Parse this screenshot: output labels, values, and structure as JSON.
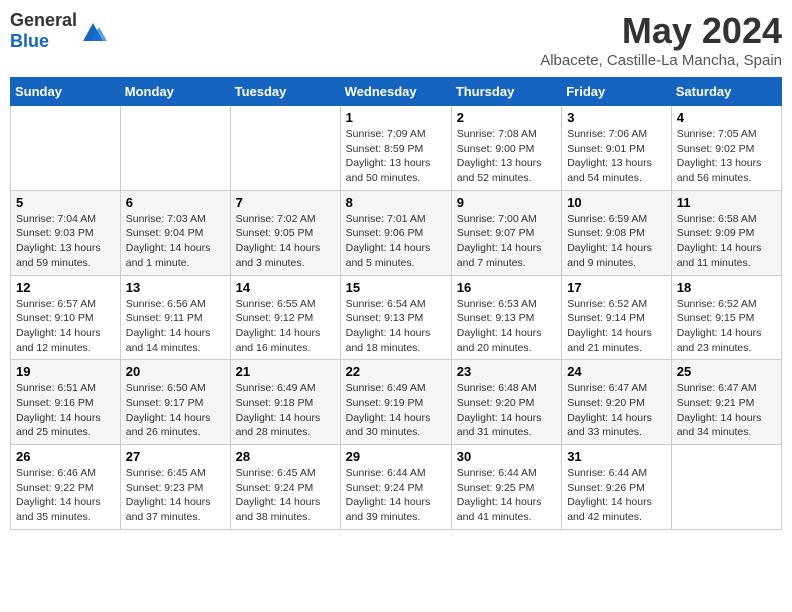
{
  "header": {
    "logo_general": "General",
    "logo_blue": "Blue",
    "month_title": "May 2024",
    "location": "Albacete, Castille-La Mancha, Spain"
  },
  "days_of_week": [
    "Sunday",
    "Monday",
    "Tuesday",
    "Wednesday",
    "Thursday",
    "Friday",
    "Saturday"
  ],
  "weeks": [
    [
      {
        "day": "",
        "sunrise": "",
        "sunset": "",
        "daylight": ""
      },
      {
        "day": "",
        "sunrise": "",
        "sunset": "",
        "daylight": ""
      },
      {
        "day": "",
        "sunrise": "",
        "sunset": "",
        "daylight": ""
      },
      {
        "day": "1",
        "sunrise": "Sunrise: 7:09 AM",
        "sunset": "Sunset: 8:59 PM",
        "daylight": "Daylight: 13 hours and 50 minutes."
      },
      {
        "day": "2",
        "sunrise": "Sunrise: 7:08 AM",
        "sunset": "Sunset: 9:00 PM",
        "daylight": "Daylight: 13 hours and 52 minutes."
      },
      {
        "day": "3",
        "sunrise": "Sunrise: 7:06 AM",
        "sunset": "Sunset: 9:01 PM",
        "daylight": "Daylight: 13 hours and 54 minutes."
      },
      {
        "day": "4",
        "sunrise": "Sunrise: 7:05 AM",
        "sunset": "Sunset: 9:02 PM",
        "daylight": "Daylight: 13 hours and 56 minutes."
      }
    ],
    [
      {
        "day": "5",
        "sunrise": "Sunrise: 7:04 AM",
        "sunset": "Sunset: 9:03 PM",
        "daylight": "Daylight: 13 hours and 59 minutes."
      },
      {
        "day": "6",
        "sunrise": "Sunrise: 7:03 AM",
        "sunset": "Sunset: 9:04 PM",
        "daylight": "Daylight: 14 hours and 1 minute."
      },
      {
        "day": "7",
        "sunrise": "Sunrise: 7:02 AM",
        "sunset": "Sunset: 9:05 PM",
        "daylight": "Daylight: 14 hours and 3 minutes."
      },
      {
        "day": "8",
        "sunrise": "Sunrise: 7:01 AM",
        "sunset": "Sunset: 9:06 PM",
        "daylight": "Daylight: 14 hours and 5 minutes."
      },
      {
        "day": "9",
        "sunrise": "Sunrise: 7:00 AM",
        "sunset": "Sunset: 9:07 PM",
        "daylight": "Daylight: 14 hours and 7 minutes."
      },
      {
        "day": "10",
        "sunrise": "Sunrise: 6:59 AM",
        "sunset": "Sunset: 9:08 PM",
        "daylight": "Daylight: 14 hours and 9 minutes."
      },
      {
        "day": "11",
        "sunrise": "Sunrise: 6:58 AM",
        "sunset": "Sunset: 9:09 PM",
        "daylight": "Daylight: 14 hours and 11 minutes."
      }
    ],
    [
      {
        "day": "12",
        "sunrise": "Sunrise: 6:57 AM",
        "sunset": "Sunset: 9:10 PM",
        "daylight": "Daylight: 14 hours and 12 minutes."
      },
      {
        "day": "13",
        "sunrise": "Sunrise: 6:56 AM",
        "sunset": "Sunset: 9:11 PM",
        "daylight": "Daylight: 14 hours and 14 minutes."
      },
      {
        "day": "14",
        "sunrise": "Sunrise: 6:55 AM",
        "sunset": "Sunset: 9:12 PM",
        "daylight": "Daylight: 14 hours and 16 minutes."
      },
      {
        "day": "15",
        "sunrise": "Sunrise: 6:54 AM",
        "sunset": "Sunset: 9:13 PM",
        "daylight": "Daylight: 14 hours and 18 minutes."
      },
      {
        "day": "16",
        "sunrise": "Sunrise: 6:53 AM",
        "sunset": "Sunset: 9:13 PM",
        "daylight": "Daylight: 14 hours and 20 minutes."
      },
      {
        "day": "17",
        "sunrise": "Sunrise: 6:52 AM",
        "sunset": "Sunset: 9:14 PM",
        "daylight": "Daylight: 14 hours and 21 minutes."
      },
      {
        "day": "18",
        "sunrise": "Sunrise: 6:52 AM",
        "sunset": "Sunset: 9:15 PM",
        "daylight": "Daylight: 14 hours and 23 minutes."
      }
    ],
    [
      {
        "day": "19",
        "sunrise": "Sunrise: 6:51 AM",
        "sunset": "Sunset: 9:16 PM",
        "daylight": "Daylight: 14 hours and 25 minutes."
      },
      {
        "day": "20",
        "sunrise": "Sunrise: 6:50 AM",
        "sunset": "Sunset: 9:17 PM",
        "daylight": "Daylight: 14 hours and 26 minutes."
      },
      {
        "day": "21",
        "sunrise": "Sunrise: 6:49 AM",
        "sunset": "Sunset: 9:18 PM",
        "daylight": "Daylight: 14 hours and 28 minutes."
      },
      {
        "day": "22",
        "sunrise": "Sunrise: 6:49 AM",
        "sunset": "Sunset: 9:19 PM",
        "daylight": "Daylight: 14 hours and 30 minutes."
      },
      {
        "day": "23",
        "sunrise": "Sunrise: 6:48 AM",
        "sunset": "Sunset: 9:20 PM",
        "daylight": "Daylight: 14 hours and 31 minutes."
      },
      {
        "day": "24",
        "sunrise": "Sunrise: 6:47 AM",
        "sunset": "Sunset: 9:20 PM",
        "daylight": "Daylight: 14 hours and 33 minutes."
      },
      {
        "day": "25",
        "sunrise": "Sunrise: 6:47 AM",
        "sunset": "Sunset: 9:21 PM",
        "daylight": "Daylight: 14 hours and 34 minutes."
      }
    ],
    [
      {
        "day": "26",
        "sunrise": "Sunrise: 6:46 AM",
        "sunset": "Sunset: 9:22 PM",
        "daylight": "Daylight: 14 hours and 35 minutes."
      },
      {
        "day": "27",
        "sunrise": "Sunrise: 6:45 AM",
        "sunset": "Sunset: 9:23 PM",
        "daylight": "Daylight: 14 hours and 37 minutes."
      },
      {
        "day": "28",
        "sunrise": "Sunrise: 6:45 AM",
        "sunset": "Sunset: 9:24 PM",
        "daylight": "Daylight: 14 hours and 38 minutes."
      },
      {
        "day": "29",
        "sunrise": "Sunrise: 6:44 AM",
        "sunset": "Sunset: 9:24 PM",
        "daylight": "Daylight: 14 hours and 39 minutes."
      },
      {
        "day": "30",
        "sunrise": "Sunrise: 6:44 AM",
        "sunset": "Sunset: 9:25 PM",
        "daylight": "Daylight: 14 hours and 41 minutes."
      },
      {
        "day": "31",
        "sunrise": "Sunrise: 6:44 AM",
        "sunset": "Sunset: 9:26 PM",
        "daylight": "Daylight: 14 hours and 42 minutes."
      },
      {
        "day": "",
        "sunrise": "",
        "sunset": "",
        "daylight": ""
      }
    ]
  ]
}
